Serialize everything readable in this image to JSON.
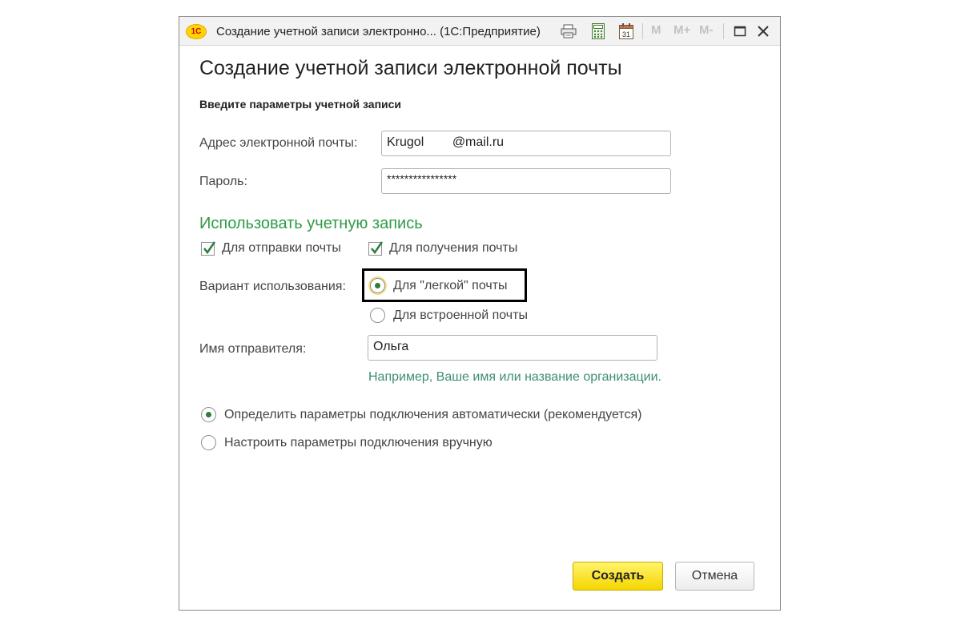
{
  "window": {
    "logo_text": "1С",
    "title": "Создание учетной записи электронно...  (1С:Предприятие)",
    "toolbar": {
      "m_label": "M",
      "mplus_label": "M+",
      "mminus_label": "M-"
    }
  },
  "form": {
    "heading": "Создание учетной записи электронной почты",
    "subheading": "Введите параметры учетной записи",
    "email": {
      "label": "Адрес электронной почты:",
      "value": "Krugol        @mail.ru"
    },
    "password": {
      "label": "Пароль:",
      "value": "****************"
    },
    "use_account": {
      "title": "Использовать учетную запись",
      "send_label": "Для отправки почты",
      "send_checked": true,
      "receive_label": "Для получения почты",
      "receive_checked": true
    },
    "usage_variant": {
      "label": "Вариант использования:",
      "options": [
        "Для \"легкой\" почты",
        "Для встроенной почты"
      ],
      "selected": 0
    },
    "sender_name": {
      "label": "Имя отправителя:",
      "value": "Ольга",
      "hint": "Например, Ваше имя или название организации."
    },
    "connection": {
      "options": [
        "Определить параметры подключения автоматически (рекомендуется)",
        "Настроить параметры подключения вручную"
      ],
      "selected": 0
    },
    "buttons": {
      "create": "Создать",
      "cancel": "Отмена"
    }
  },
  "colors": {
    "group_title": "#2e9a46",
    "hint": "#3c8f71",
    "check_mark": "#2e7d3f",
    "primary_button": "#f5d600"
  },
  "icons": [
    "print-icon",
    "calculator-icon",
    "calendar-icon",
    "maximize-icon",
    "close-icon",
    "checkmark-icon"
  ]
}
